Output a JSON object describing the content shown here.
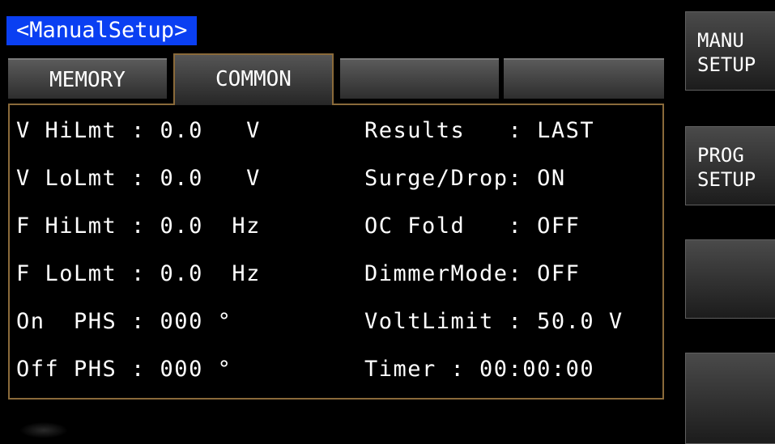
{
  "title": "<ManualSetup>",
  "tabs": [
    {
      "label": "MEMORY"
    },
    {
      "label": "COMMON"
    },
    {
      "label": ""
    },
    {
      "label": ""
    }
  ],
  "left_rows": [
    "V HiLmt : 0.0   V",
    "V LoLmt : 0.0   V",
    "F HiLmt : 0.0  Hz",
    "F LoLmt : 0.0  Hz",
    "On  PHS : 000 °",
    "Off PHS : 000 °"
  ],
  "right_rows": [
    "Results   : LAST",
    "Surge/Drop: ON",
    "OC Fold   : OFF",
    "DimmerMode: OFF",
    "VoltLimit : 50.0 V",
    "Timer : 00:00:00"
  ],
  "side_buttons": [
    {
      "label": "MANU\nSETUP"
    },
    {
      "label": "PROG\nSETUP"
    },
    {
      "label": ""
    },
    {
      "label": ""
    }
  ],
  "colors": {
    "title_bg": "#0a3ff2",
    "panel_border": "#8a6a3a",
    "background": "#000000",
    "text": "#ffffff"
  }
}
